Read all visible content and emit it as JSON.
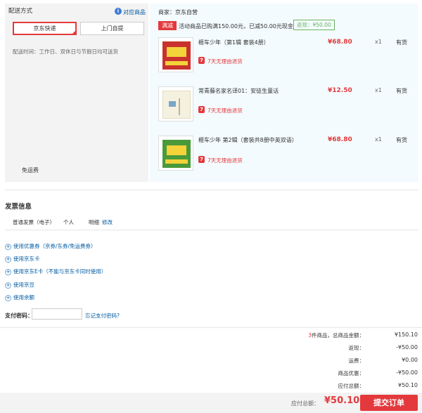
{
  "delivery": {
    "title": "配送方式",
    "match_link": "对应商品",
    "jd_express": "京东快递",
    "pickup": "上门自提",
    "time_label": "配送时间：",
    "time_value": "工作日、双休日与节假日均可送货",
    "free_shipping": "免运费"
  },
  "order": {
    "merchant": "商家：京东自营",
    "promo_tag": "满减",
    "promo_text": "活动商品已购满150.00元，已减50.00元现金",
    "savings": "返现：¥50.00",
    "products": [
      {
        "name": "榧车少年（第1辑 套装4册）",
        "price": "¥68.80",
        "qty": "x1",
        "stock": "有货",
        "return_policy": "7天无理由退货",
        "cover_color": "#c8312d"
      },
      {
        "name": "常青藤名家名译01：安徒生童话",
        "price": "¥12.50",
        "qty": "x1",
        "stock": "有货",
        "return_policy": "7天无理由退货",
        "cover_color": "#f5f1e0"
      },
      {
        "name": "榧车少年 第2辑（套装共8册中英双语）",
        "price": "¥68.80",
        "qty": "x1",
        "stock": "有货",
        "return_policy": "7天无理由退货",
        "cover_color": "#4a9a3a"
      }
    ]
  },
  "invoice": {
    "title": "发票信息",
    "type": "普通发票（电子）",
    "person": "个人",
    "detail": "明细",
    "edit": "修改"
  },
  "options": [
    "使用优惠券（京券/东券/免运费券）",
    "使用京东卡",
    "使用京东E卡（不能与京东卡同时使用）",
    "使用京豆",
    "使用余额"
  ],
  "payment_password": {
    "label": "支付密码：",
    "forgot": "忘记支付密码?"
  },
  "summary": {
    "count": "3",
    "count_suffix": "件商品，总商品金额：",
    "rows": [
      {
        "label": "返现：",
        "value": "-¥50.00"
      },
      {
        "label": "运费：",
        "value": "¥0.00"
      },
      {
        "label": "商品优惠：",
        "value": "-¥50.00"
      },
      {
        "label": "应付总额：",
        "value": "¥50.10"
      }
    ],
    "total_goods": "¥150.10"
  },
  "footer": {
    "total_label": "应付总额：",
    "total_amount": "¥50.10",
    "submit": "提交订单"
  }
}
